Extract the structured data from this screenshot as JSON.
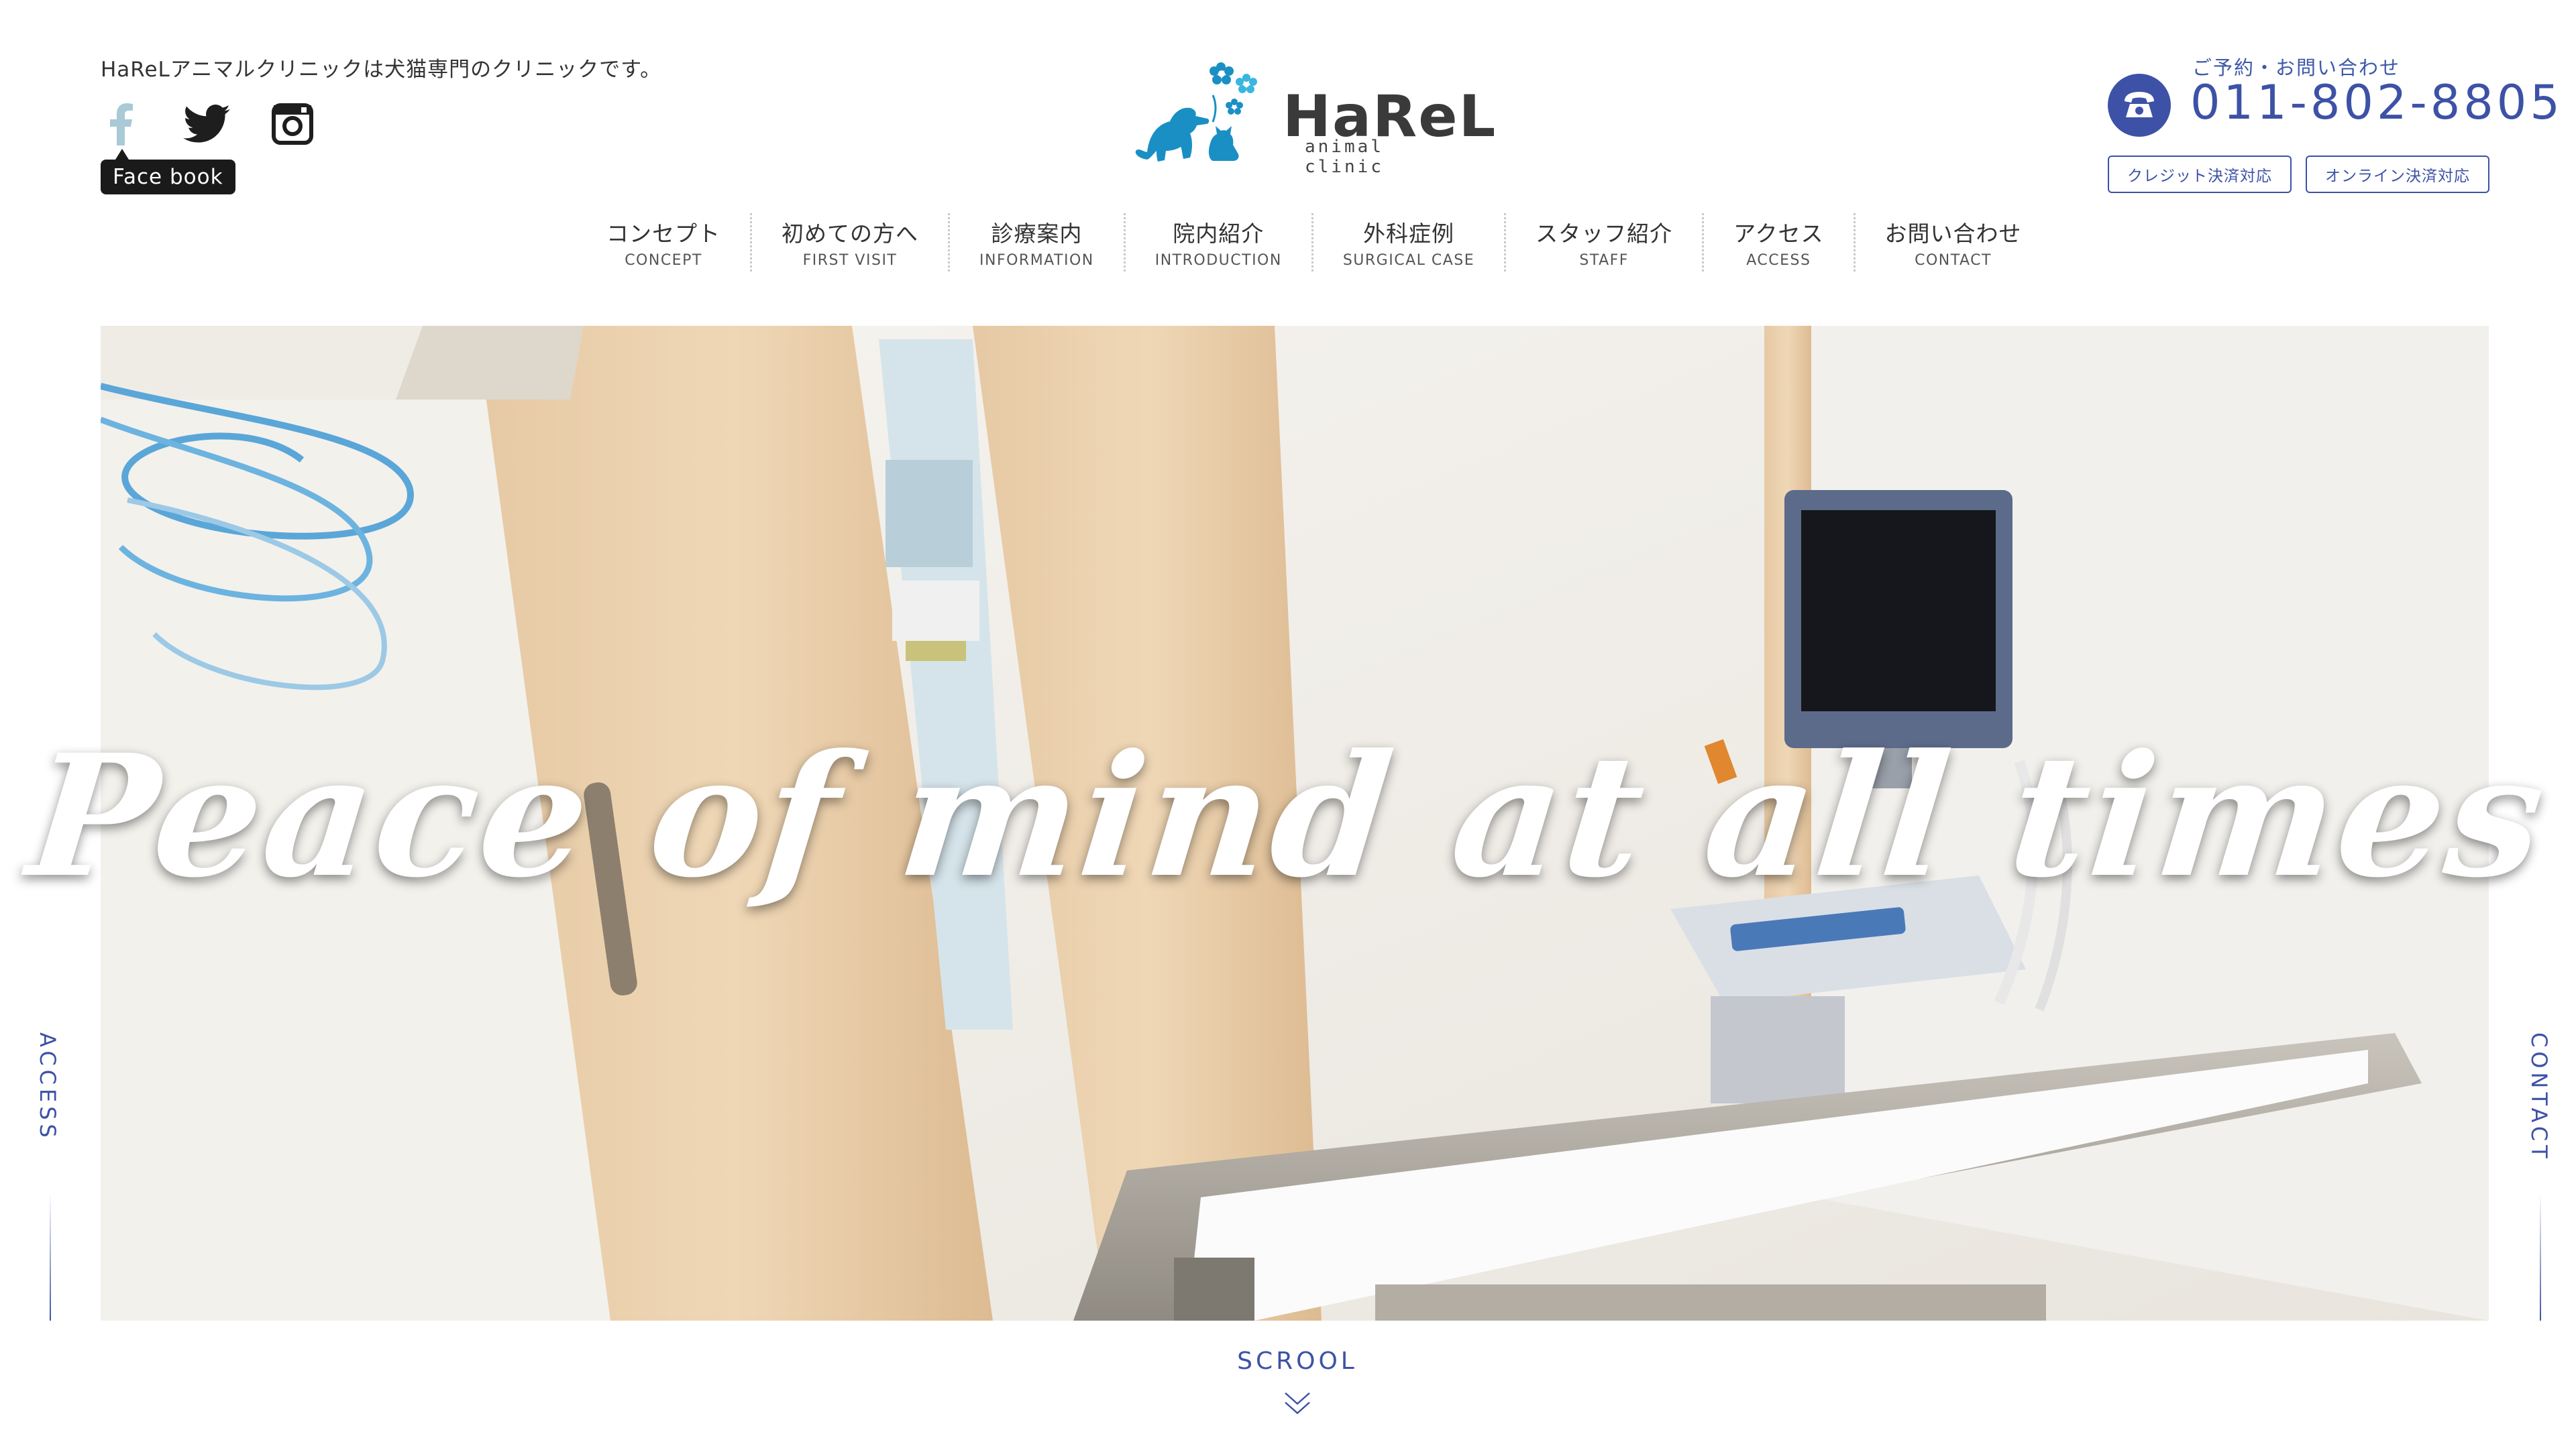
{
  "header": {
    "tagline": "HaReLアニマルクリニックは犬猫専門のクリニックです。",
    "social": [
      {
        "icon": "facebook-icon"
      },
      {
        "icon": "twitter-icon"
      },
      {
        "icon": "instagram-icon"
      }
    ],
    "tooltip": "Face book",
    "logo": {
      "name": "HaReL",
      "sub": "animal clinic"
    },
    "contact_label": "ご予約・お問い合わせ",
    "phone": "011-802-8805",
    "payment_buttons": [
      "クレジット決済対応",
      "オンライン決済対応"
    ]
  },
  "nav": [
    {
      "ja": "コンセプト",
      "en": "CONCEPT"
    },
    {
      "ja": "初めての方へ",
      "en": "FIRST VISIT"
    },
    {
      "ja": "診療案内",
      "en": "INFORMATION"
    },
    {
      "ja": "院内紹介",
      "en": "INTRODUCTION"
    },
    {
      "ja": "外科症例",
      "en": "SURGICAL CASE"
    },
    {
      "ja": "スタッフ紹介",
      "en": "STAFF"
    },
    {
      "ja": "アクセス",
      "en": "ACCESS"
    },
    {
      "ja": "お問い合わせ",
      "en": "CONTACT"
    }
  ],
  "hero": {
    "headline": "Peace of mind at all times"
  },
  "side": {
    "left": "ACCESS",
    "right": "CONTACT"
  },
  "scroll": "SCROOL",
  "colors": {
    "accent": "#3d52a6",
    "logo_blue": "#1a8fc4"
  }
}
